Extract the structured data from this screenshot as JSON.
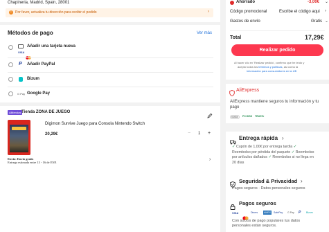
{
  "address": {
    "line": "Chapineria, Madrid, Spain, 28001",
    "notice": "Por favor, actualiza tu dirección para recibir el pedido"
  },
  "payment": {
    "title": "Métodos de pago",
    "see_more": "Ver más",
    "options": [
      {
        "label": "Añadir una tarjeta nueva",
        "icon": "card-icon"
      },
      {
        "label": "Añadir PayPal",
        "icon": "paypal-icon"
      },
      {
        "label": "Bizum",
        "icon": "bizum-icon"
      },
      {
        "label": "Google Pay",
        "icon": "gpay-icon"
      }
    ],
    "card_brands": [
      "VISA",
      "mastercard"
    ],
    "gpay_mark": "G Pay"
  },
  "store": {
    "badge": "Alltiendas",
    "name": "Tienda ZONA DE JUEGO",
    "product_title": "Digimon Survive Juego para Consola Nintendo Switch",
    "price": "20,29€",
    "quantity": "1",
    "minus": "−",
    "plus": "+",
    "shipping_title": "Envío: Envío gratis",
    "shipping_detail": "Entrega estimada entre 13 - 16 de ENE"
  },
  "summary": {
    "savings_label": "Ahorrado",
    "savings_value": "-3,00€",
    "promo_label": "Código promocional",
    "promo_placeholder": "Escribe el código aqui",
    "shipping_label": "Gastos de envío",
    "shipping_value": "Gratis",
    "total_label": "Total",
    "total_value": "17,29€",
    "order_button": "Realizar pedido",
    "legal_1": "Al hacer clic en 'Realizar pedido', confirmo que he leído y",
    "legal_2a": "acepto todos los ",
    "legal_2b": "términos y políticas",
    "legal_2c": ", así como la",
    "legal_3": "información para consumidores en la UE."
  },
  "trust": {
    "brand": "AliExpress",
    "statement": "AliExpress mantiene seguros tu información y tu pago",
    "badges": [
      "norton",
      "PCI DSS",
      "TRUSTe"
    ]
  },
  "delivery": {
    "title": "Entrega rápida",
    "lines": [
      "Cupón de 1,00€ por entrega tardía",
      "Reembolso por pérdida del paquete",
      "Reembolso",
      "por artículos dañados",
      "Reembolso si no llega en",
      "20 días"
    ]
  },
  "security": {
    "title": "Seguridad & Privacidad",
    "subtitle": "Pagos seguros · Datos personales seguros"
  },
  "secure_pay": {
    "title": "Pagos seguros",
    "logos": [
      "VISA",
      "MC",
      "Diners",
      "AMEX",
      "SafePay",
      "G Pay",
      "P",
      "Bizum"
    ],
    "description_1": "Con socios de pago populares tus datos",
    "description_2": "personales están seguros."
  },
  "colors": {
    "accent": "#fd384f",
    "brand_red": "#e02b2b",
    "link": "#1a6dd9",
    "green": "#1d8a4a"
  }
}
